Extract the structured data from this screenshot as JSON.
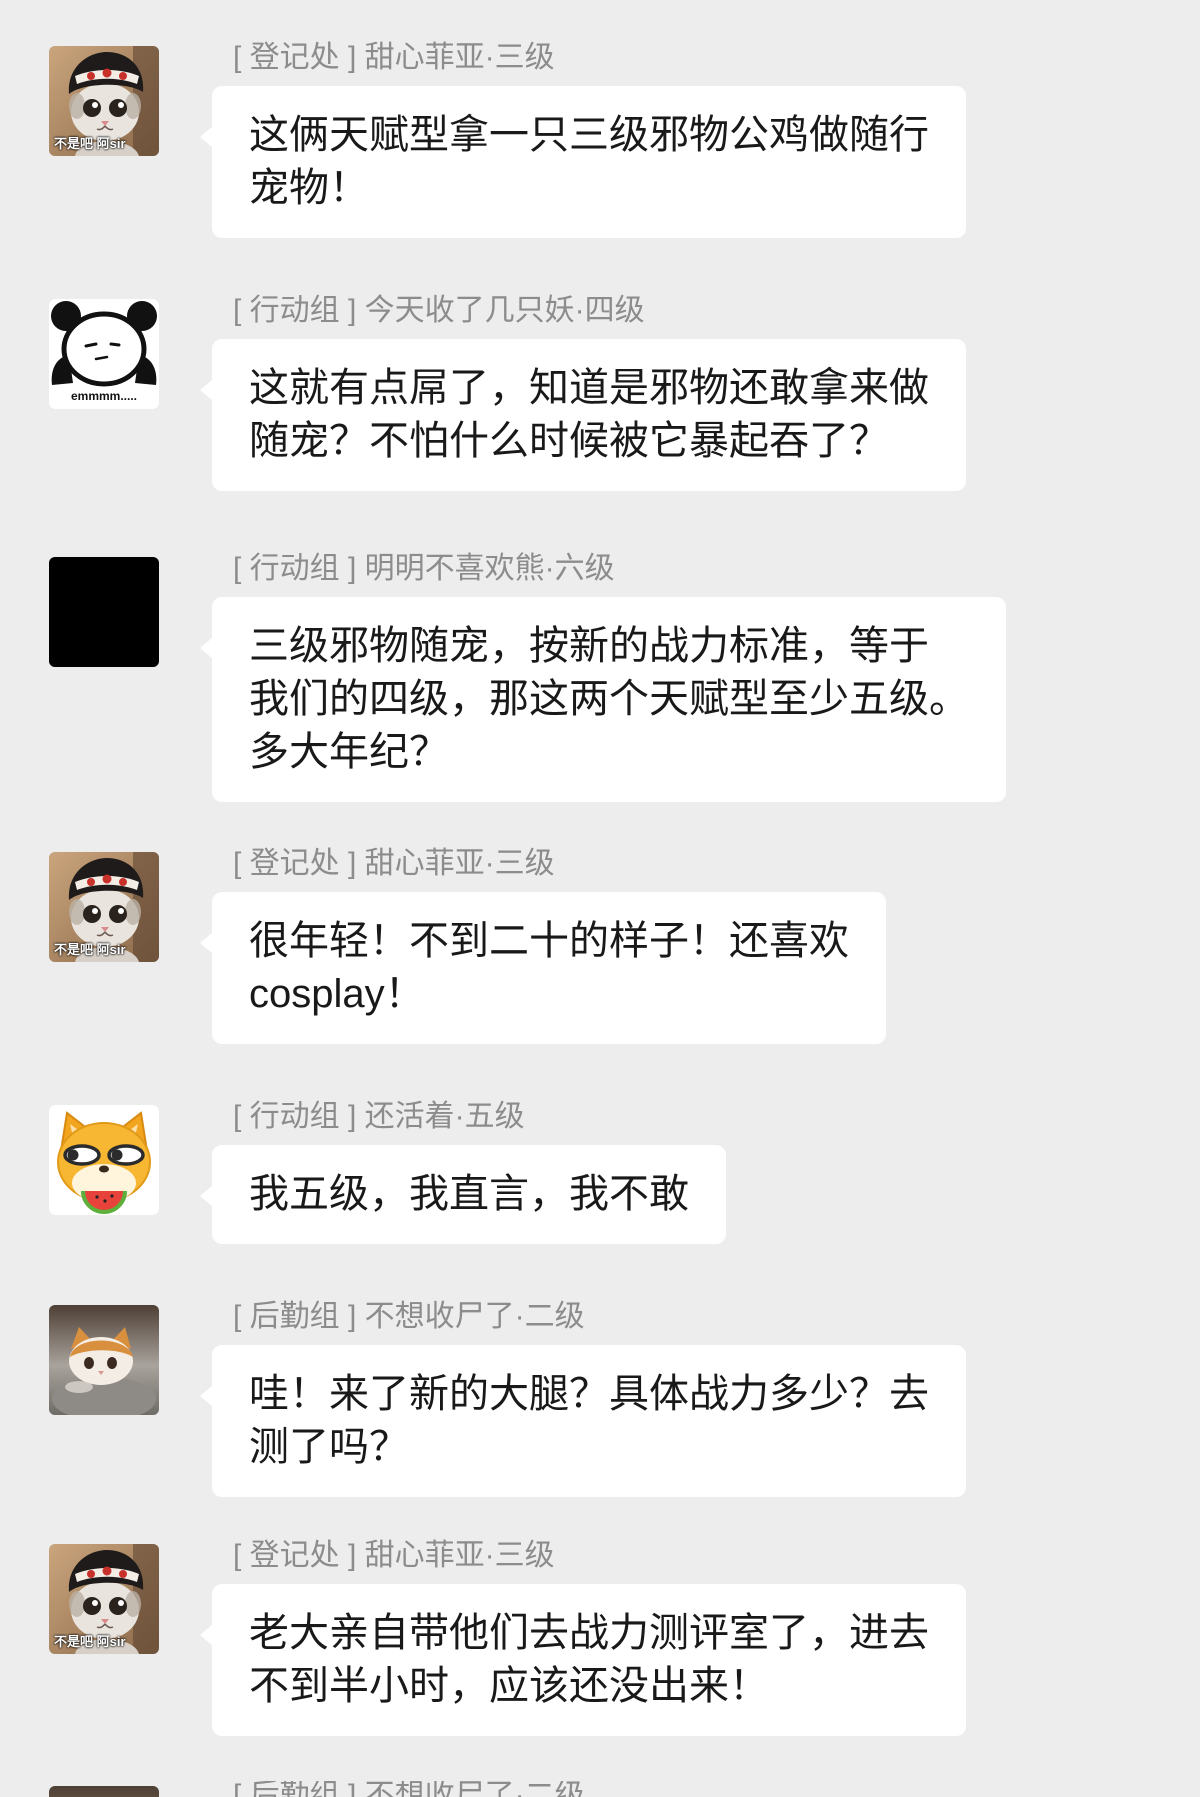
{
  "theme": {
    "background": "#ededed",
    "bubble": "#ffffff",
    "sender_text": "#8c8c8c",
    "message_text": "#191919"
  },
  "avatars": {
    "cat_in_hat": {
      "icon": "cat-in-hat-sticker-icon",
      "caption": "不是吧 阿sir"
    },
    "panda": {
      "icon": "panda-meme-icon",
      "caption": "emmmm....."
    },
    "black": {
      "icon": "black-square-avatar"
    },
    "shiba": {
      "icon": "shiba-dog-emoji-icon"
    },
    "sad_kitten": {
      "icon": "sad-kitten-photo-icon"
    }
  },
  "messages": [
    {
      "avatar": "cat_in_hat",
      "sender": "[ 登记处 ] 甜心菲亚·三级",
      "lines": [
        "这俩天赋型拿一只三级邪物公鸡做随行",
        "宠物！"
      ]
    },
    {
      "avatar": "panda",
      "sender": "[ 行动组 ] 今天收了几只妖·四级",
      "lines": [
        "这就有点屌了，知道是邪物还敢拿来做",
        "随宠？不怕什么时候被它暴起吞了？"
      ]
    },
    {
      "avatar": "black",
      "sender": "[ 行动组 ] 明明不喜欢熊·六级",
      "lines": [
        "三级邪物随宠，按新的战力标准，等于",
        "我们的四级，那这两个天赋型至少五级。",
        "多大年纪？"
      ]
    },
    {
      "avatar": "cat_in_hat",
      "sender": "[ 登记处 ] 甜心菲亚·三级",
      "lines": [
        "很年轻！不到二十的样子！还喜欢",
        "cosplay！"
      ]
    },
    {
      "avatar": "shiba",
      "sender": "[ 行动组 ] 还活着·五级",
      "lines": [
        "我五级，我直言，我不敢"
      ]
    },
    {
      "avatar": "sad_kitten",
      "sender": "[ 后勤组 ] 不想收尸了·二级",
      "lines": [
        "哇！来了新的大腿？具体战力多少？去",
        "测了吗？"
      ]
    },
    {
      "avatar": "cat_in_hat",
      "sender": "[ 登记处 ] 甜心菲亚·三级",
      "lines": [
        "老大亲自带他们去战力测评室了，进去",
        "不到半小时，应该还没出来！"
      ]
    },
    {
      "avatar": "sad_kitten",
      "sender": "[ 后勤组 ] 不想收尸了·二级",
      "lines": []
    }
  ]
}
